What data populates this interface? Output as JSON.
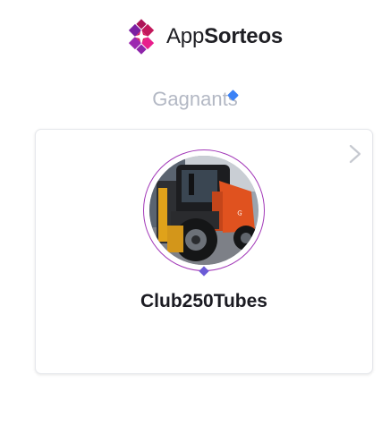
{
  "brand": {
    "name_regular": "App",
    "name_bold": "Sorteos",
    "logo_icon": "sparkle-diamond-logo",
    "colors": {
      "logo_primary": "#b5179e",
      "logo_secondary": "#7c3aed",
      "text": "#1f1f24"
    }
  },
  "section": {
    "title": "Gagnants"
  },
  "winners": [
    {
      "name": "Club250Tubes",
      "avatar_icon": "forklift-photo-avatar",
      "ring_color": "#a238b8"
    }
  ],
  "icons": {
    "next": "chevron-right-icon"
  }
}
